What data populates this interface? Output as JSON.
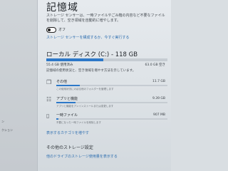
{
  "page": {
    "title": "記憶域",
    "description": "ストレージ センサーは、一時ファイルやごみ箱の内容など不要なファイルを削除して、空き領域を自動的に増やします。",
    "toggle_state": "オフ",
    "toggle_on": false,
    "configure_link": "ストレージ センサーを構成するか、今すぐ実行する"
  },
  "nav": {
    "items": [
      {
        "label": "ン"
      },
      {
        "label": "クション"
      }
    ]
  },
  "drive": {
    "title": "ローカル ディスク (C:) - 118 GB",
    "used_text": "55.4 GB 使用済み",
    "free_text": "63.0 GB 空き",
    "used_fraction": 0.47,
    "info": "記憶域の使用状況と、空き領域を増やす方法を示しています。",
    "categories": [
      {
        "name": "その他",
        "size": "11.7 GB",
        "fraction": 0.21,
        "description": "この使用状況にのぼる他のフォルダーを管理します",
        "icon": "folder-icon",
        "glyph": "❒"
      },
      {
        "name": "アプリと機能",
        "size": "9.39 GB",
        "fraction": 0.17,
        "description": "アプリと機能をアンインストールまたは変更します",
        "icon": "apps-icon",
        "glyph": "☷"
      },
      {
        "name": "一時ファイル",
        "size": "907 MB",
        "fraction": 0.02,
        "description": "不要になった一時ファイルを削除します",
        "icon": "trash-icon",
        "glyph": "▯"
      }
    ],
    "more_link": "表示するカテゴリを増やす"
  },
  "other_storage": {
    "title": "その他のストレージ設定",
    "link": "他のドライブのストレージ使用量を表示する"
  },
  "colors": {
    "accent": "#2d78c8",
    "link": "#2f6fb0"
  }
}
